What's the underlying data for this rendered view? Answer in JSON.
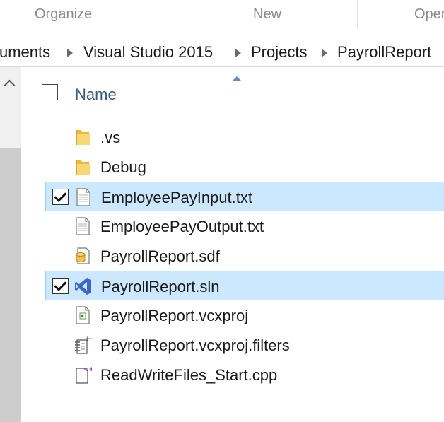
{
  "ribbon": {
    "groups": [
      {
        "label": "Organize"
      },
      {
        "label": "New"
      },
      {
        "label": "Open"
      }
    ]
  },
  "breadcrumb": {
    "segments": [
      "uments",
      "Visual Studio 2015",
      "Projects",
      "PayrollReport"
    ]
  },
  "column_header": {
    "name_label": "Name",
    "sort": "ascending"
  },
  "files": [
    {
      "name": ".vs",
      "icon": "folder-icon",
      "selected": false
    },
    {
      "name": "Debug",
      "icon": "folder-icon",
      "selected": false
    },
    {
      "name": "EmployeePayInput.txt",
      "icon": "text-file-icon",
      "selected": true
    },
    {
      "name": "EmployeePayOutput.txt",
      "icon": "text-file-icon",
      "selected": false
    },
    {
      "name": "PayrollReport.sdf",
      "icon": "database-file-icon",
      "selected": false
    },
    {
      "name": "PayrollReport.sln",
      "icon": "visual-studio-solution-icon",
      "selected": true
    },
    {
      "name": "PayrollReport.vcxproj",
      "icon": "project-file-icon",
      "selected": false
    },
    {
      "name": "PayrollReport.vcxproj.filters",
      "icon": "filters-file-icon",
      "selected": false
    },
    {
      "name": "ReadWriteFiles_Start.cpp",
      "icon": "cpp-file-icon",
      "selected": false
    }
  ],
  "colors": {
    "selection_bg": "#cce8ff",
    "selection_border": "#99d1ff",
    "header_text": "#3c5a80",
    "vs_purple": "#68217a"
  }
}
